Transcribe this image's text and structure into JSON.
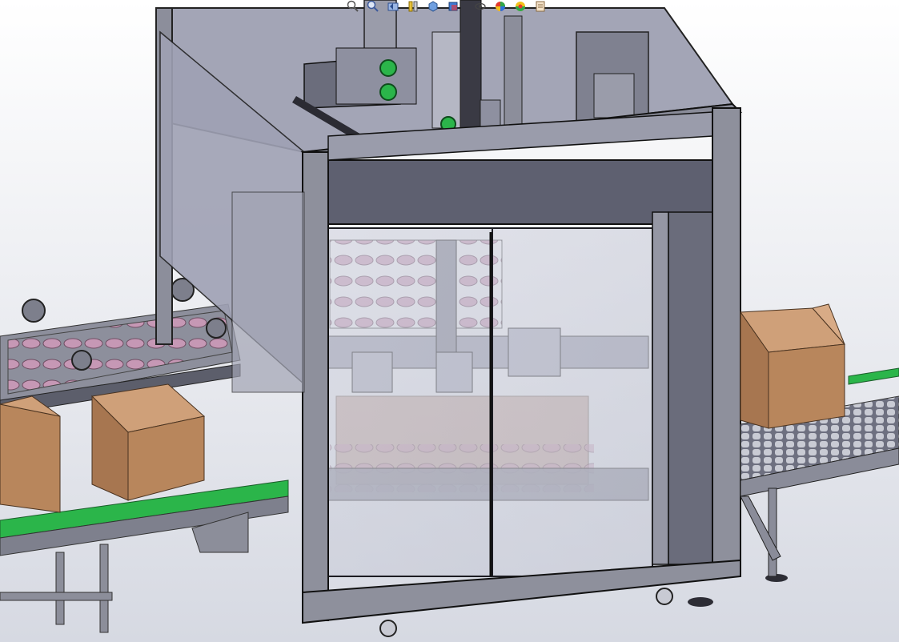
{
  "app": {
    "name": "",
    "window_title": ""
  },
  "heads_up_toolbar": {
    "items": [
      {
        "name": "zoom-to-fit-icon"
      },
      {
        "name": "zoom-to-area-icon"
      },
      {
        "name": "previous-view-icon"
      },
      {
        "name": "section-view-icon"
      },
      {
        "name": "view-orientation-icon"
      },
      {
        "name": "display-style-icon"
      },
      {
        "name": "hide-show-items-icon"
      },
      {
        "name": "edit-appearance-icon"
      },
      {
        "name": "apply-scene-icon"
      },
      {
        "name": "view-settings-icon"
      }
    ]
  },
  "colors": {
    "background_top": "#ffffff",
    "background_bottom": "#c9cdd8",
    "frame_gray": "#8c8c98",
    "frame_dark": "#5f6070",
    "panel_blue_gray": "#9d9fb3",
    "container_pink": "#b78aa6",
    "cardboard": "#b8865c",
    "green_belt": "#2bb54a",
    "glass": "#d4d6e2"
  },
  "model": {
    "description_visible_text": ""
  }
}
